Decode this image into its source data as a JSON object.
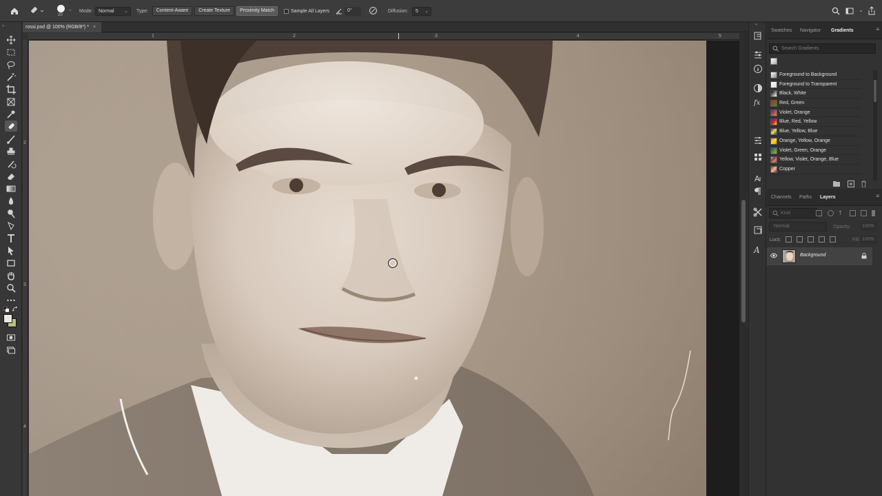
{
  "options_bar": {
    "brush_size": "20",
    "mode_label": "Mode:",
    "mode_value": "Normal",
    "type_label": "Type:",
    "type_options": [
      "Content-Aware",
      "Create Texture",
      "Proximity Match"
    ],
    "active_type": "Proximity Match",
    "sample_all_layers": "Sample All Layers",
    "angle": "0°",
    "diffusion_label": "Diffusion:",
    "diffusion_value": "5"
  },
  "document": {
    "tab_title": "rossi.psd @ 100% (RGB/8*) *",
    "ruler_top_numbers": [
      "1",
      "2",
      "3",
      "4",
      "5"
    ],
    "ruler_left_numbers": [
      "2",
      "3",
      "4"
    ]
  },
  "panels": {
    "top_tabs": [
      "Swatches",
      "Navigator",
      "Gradients"
    ],
    "active_top_tab": "Gradients",
    "search_placeholder": "Search Gradients",
    "gradients": [
      {
        "name": "Foreground to Background",
        "colors": [
          "#ffffff",
          "#888888"
        ]
      },
      {
        "name": "Foreground to Transparent",
        "colors": [
          "#ffffff",
          "#d8d8d8"
        ]
      },
      {
        "name": "Black, White",
        "colors": [
          "#000000",
          "#ffffff"
        ]
      },
      {
        "name": "Red, Green",
        "colors": [
          "#d21a1a",
          "#2f9c2a"
        ]
      },
      {
        "name": "Violet, Orange",
        "colors": [
          "#5a1f8f",
          "#f5881f"
        ]
      },
      {
        "name": "Blue, Red, Yellow",
        "colors": [
          "#1d33c8",
          "#e21c1c",
          "#f7e324"
        ]
      },
      {
        "name": "Blue, Yellow, Blue",
        "colors": [
          "#1d33c8",
          "#f7e324",
          "#1d33c8"
        ]
      },
      {
        "name": "Orange, Yellow, Orange",
        "colors": [
          "#f07d14",
          "#f7e324",
          "#f07d14"
        ]
      },
      {
        "name": "Violet, Green, Orange",
        "colors": [
          "#6a1f9a",
          "#2aa73f",
          "#f08a1c"
        ]
      },
      {
        "name": "Yellow, Violet, Orange, Blue",
        "colors": [
          "#f7e324",
          "#7b2aa2",
          "#f08a1c",
          "#2040c8"
        ]
      },
      {
        "name": "Copper",
        "colors": [
          "#8a3c22",
          "#f3b79a",
          "#8a3c22"
        ]
      }
    ],
    "bottom_tabs": [
      "Channels",
      "Paths",
      "Layers"
    ],
    "active_bottom_tab": "Layers",
    "layers_kind": "Kind",
    "blend_mode": "Normal",
    "opacity_label": "Opacity:",
    "opacity_value": "100%",
    "lock_label": "Lock:",
    "fill_label": "Fill:",
    "fill_value": "100%",
    "layer_name": "Background"
  }
}
